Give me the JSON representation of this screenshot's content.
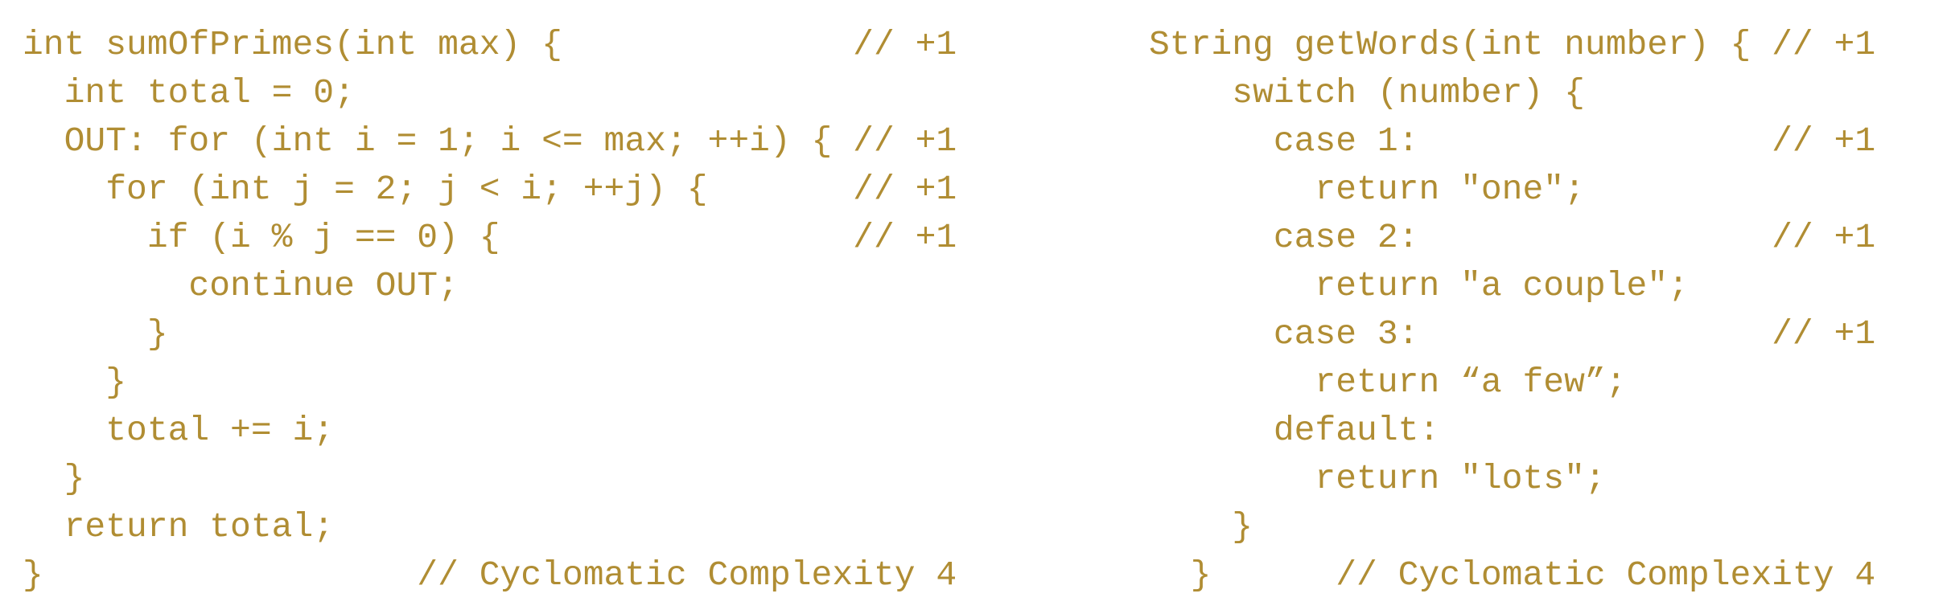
{
  "left_snippet": {
    "lines": [
      "int sumOfPrimes(int max) {              // +1",
      "  int total = 0;",
      "  OUT: for (int i = 1; i <= max; ++i) { // +1",
      "    for (int j = 2; j < i; ++j) {       // +1",
      "      if (i % j == 0) {                 // +1",
      "        continue OUT;",
      "      }",
      "    }",
      "    total += i;",
      "  }",
      "  return total;",
      "}                  // Cyclomatic Complexity 4"
    ]
  },
  "right_snippet": {
    "lines": [
      "String getWords(int number) { // +1",
      "    switch (number) {",
      "      case 1:                 // +1",
      "        return \"one\";",
      "      case 2:                 // +1",
      "        return \"a couple\";",
      "      case 3:                 // +1",
      "        return “a few”;",
      "      default:",
      "        return \"lots\";",
      "    }",
      "  }      // Cyclomatic Complexity 4"
    ]
  },
  "colors": {
    "code_text": "#b08d33",
    "background": "#ffffff"
  }
}
